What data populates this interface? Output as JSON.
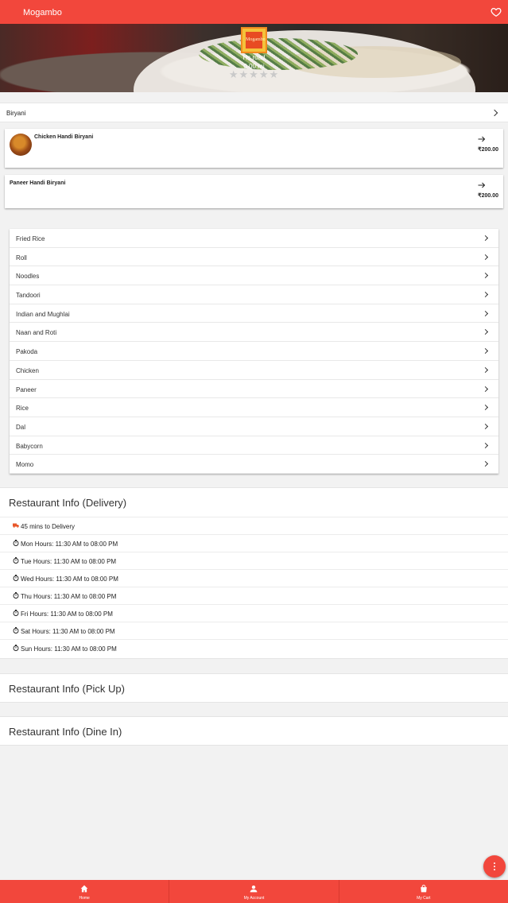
{
  "topbar": {
    "title": "Mogambo",
    "favorite_icon": "heart-outline-icon"
  },
  "hero": {
    "logo_text": "Mogambo",
    "location": "Hs road",
    "distance": "0.00 mi",
    "stars": "★★★★★"
  },
  "open_category": {
    "label": "Biryani",
    "dishes": [
      {
        "name": "Chicken Handi Biryani",
        "price": "₹200.00",
        "has_image": true
      },
      {
        "name": "Paneer Handi Biryani",
        "price": "₹200.00",
        "has_image": false
      }
    ]
  },
  "categories": [
    "Fried Rice",
    "Roll",
    "Noodles",
    "Tandoori",
    "Indian and Mughlai",
    "Naan and Roti",
    "Pakoda",
    "Chicken",
    "Paneer",
    "Rice",
    "Dal",
    "Babycorn",
    "Momo"
  ],
  "delivery_info": {
    "heading": "Restaurant Info (Delivery)",
    "delivery_time": "45 mins to Delivery",
    "hours": [
      "Mon Hours: 11:30 AM to 08:00 PM",
      "Tue Hours: 11:30 AM to 08:00 PM",
      "Wed Hours: 11:30 AM to 08:00 PM",
      "Thu Hours: 11:30 AM to 08:00 PM",
      "Fri Hours: 11:30 AM to 08:00 PM",
      "Sat Hours: 11:30 AM to 08:00 PM",
      "Sun Hours: 11:30 AM to 08:00 PM"
    ]
  },
  "pickup_info": {
    "heading": "Restaurant Info (Pick Up)"
  },
  "dinein_info": {
    "heading": "Restaurant Info (Dine In)"
  },
  "bottom_nav": [
    {
      "label": "Home",
      "icon": "home-icon"
    },
    {
      "label": "My Account",
      "icon": "person-icon"
    },
    {
      "label": "My Cart",
      "icon": "shopping-bag-icon"
    }
  ],
  "colors": {
    "primary": "#f2473c",
    "truck_icon": "#e8572a"
  }
}
